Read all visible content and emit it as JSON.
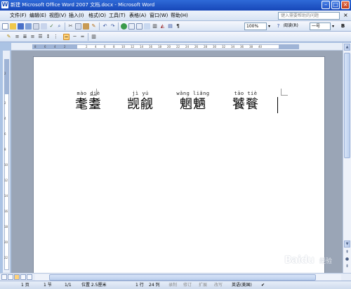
{
  "window": {
    "title": "新建 Microsoft Office Word 2007 文档.docx - Microsoft Word",
    "icon_letter": "W",
    "minimize": "–",
    "restore": "□",
    "close": "×"
  },
  "menu": {
    "items": [
      "文件(F)",
      "编辑(E)",
      "视图(V)",
      "插入(I)",
      "格式(O)",
      "工具(T)",
      "表格(A)",
      "窗口(W)",
      "帮助(H)"
    ],
    "help_placeholder": "键入需要帮助的问题",
    "close": "×"
  },
  "toolbar": {
    "zoom": "100%",
    "reading_label": "阅读(R)",
    "font_size": "一号"
  },
  "ruler": {
    "numbers": [
      "8",
      "6",
      "4",
      "2",
      "2",
      "4",
      "6",
      "8",
      "10",
      "12",
      "14",
      "16",
      "18",
      "20",
      "22",
      "24",
      "26",
      "28",
      "30",
      "32",
      "34",
      "36",
      "38",
      "40"
    ]
  },
  "vruler": {
    "numbers": [
      "2",
      "2",
      "4",
      "6",
      "8",
      "10",
      "12",
      "14",
      "16",
      "18",
      "20",
      "22"
    ]
  },
  "document": {
    "pairs": [
      {
        "pinyin": "mào diè",
        "hanzi": "耄耋"
      },
      {
        "pinyin": "jì yú",
        "hanzi": "觊觎"
      },
      {
        "pinyin": "wǎng liǎng",
        "hanzi": "魍魉"
      },
      {
        "pinyin": "tāo tiè",
        "hanzi": "饕餮"
      }
    ]
  },
  "status": {
    "page": "1 页",
    "section": "1 节",
    "page_of": "1/1",
    "position": "位置 2.5厘米",
    "line": "1 行",
    "column": "24 列",
    "rec": "录制",
    "trk": "修订",
    "ext": "扩展",
    "ovr": "改写",
    "language": "英语(美国)"
  },
  "watermark": {
    "logo": "Baidu",
    "sub": "经验"
  },
  "colors": {
    "titlebar": "#1c50b8",
    "workspace": "#9aa5b6",
    "page": "#ffffff"
  }
}
